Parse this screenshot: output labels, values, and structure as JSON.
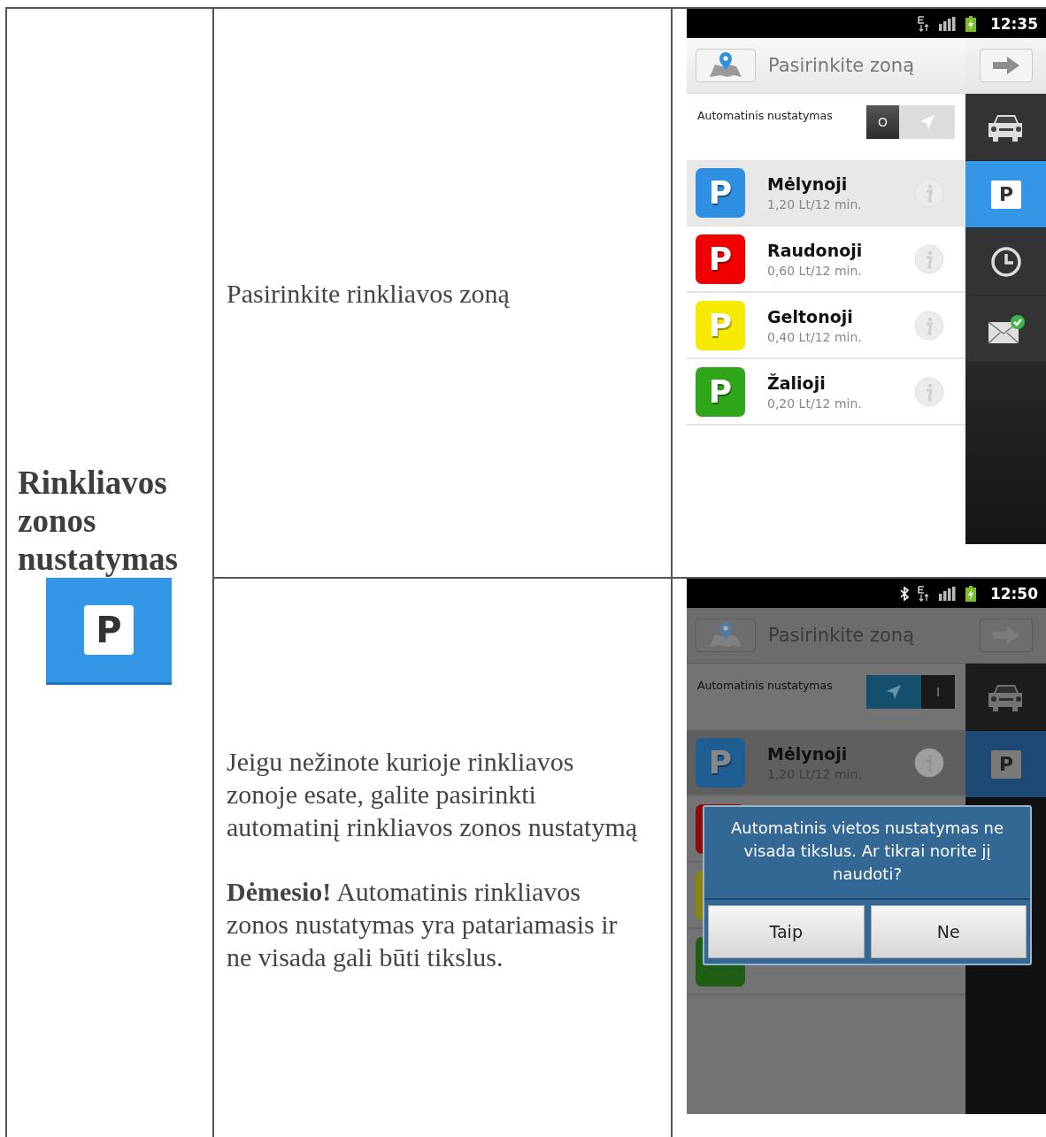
{
  "heading": "Rinkliavos zonos nustatymas",
  "heading_icon": {
    "letter": "P"
  },
  "rows": [
    {
      "paragraphs": [
        "Pasirinkite rinkliavos zoną"
      ],
      "screen": {
        "status": {
          "time": "12:35"
        },
        "title": "Pasirinkite zoną",
        "dimmed": false,
        "auto": {
          "label": "Automatinis nustatymas",
          "on": false,
          "mark": "O"
        },
        "zones": [
          {
            "letter": "P",
            "name": "Mėlynoji",
            "price": "1,20 Lt/12 min.",
            "color": "#2f8fe0",
            "selected": true
          },
          {
            "letter": "P",
            "name": "Raudonoji",
            "price": "0,60 Lt/12 min.",
            "color": "#f20000",
            "selected": false
          },
          {
            "letter": "P",
            "name": "Geltonoji",
            "price": "0,40 Lt/12 min.",
            "color": "#f5ea00",
            "selected": false
          },
          {
            "letter": "P",
            "name": "Žalioji",
            "price": "0,20 Lt/12 min.",
            "color": "#2fa51a",
            "selected": false
          }
        ],
        "sidebar": [
          {
            "kind": "car",
            "selected": false
          },
          {
            "kind": "parking",
            "letter": "P",
            "selected": true
          },
          {
            "kind": "clock",
            "selected": false
          },
          {
            "kind": "mail",
            "selected": false
          }
        ]
      }
    },
    {
      "paragraphs": [
        "Jeigu nežinote kurioje rinkliavos zonoje esate, galite pasirinkti automatinį rinkliavos zonos nustatymą",
        "**Dėmesio!** Automatinis rinkliavos zonos nustatymas yra patariamasis ir ne visada gali būti tikslus."
      ],
      "screen": {
        "status": {
          "bluetooth": true,
          "time": "12:50"
        },
        "title": "Pasirinkite zoną",
        "dimmed": true,
        "auto": {
          "label": "Automatinis nustatymas",
          "on": true,
          "mark": "I"
        },
        "zones": [
          {
            "letter": "P",
            "name": "Mėlynoji",
            "price": "1,20 Lt/12 min.",
            "color": "#1f5e93",
            "selected": true
          },
          {
            "color": "#8c0a0a",
            "selected": false
          },
          {
            "color": "#8a8410",
            "selected": false
          },
          {
            "color": "#1f5c14",
            "selected": false
          }
        ],
        "sidebar": [
          {
            "kind": "car",
            "selected": false
          },
          {
            "kind": "parking",
            "letter": "P",
            "selected": true
          }
        ],
        "dialog": {
          "message": "Automatinis vietos nustatymas ne visada tikslus. Ar tikrai norite jį naudoti?",
          "buttons": [
            "Taip",
            "Ne"
          ]
        }
      }
    }
  ]
}
